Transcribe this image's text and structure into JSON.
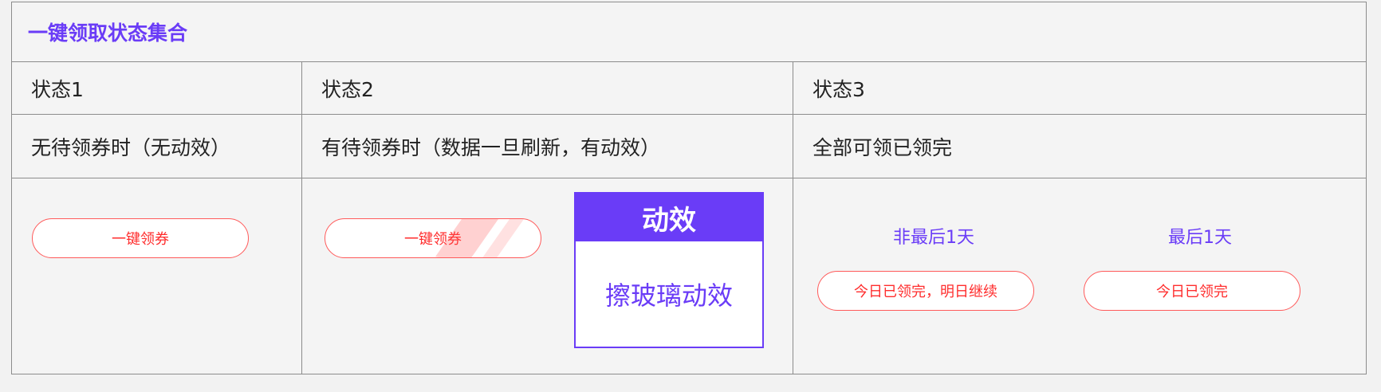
{
  "title": "一键领取状态集合",
  "columns": [
    {
      "header": "状态1",
      "desc": "无待领券时（无动效）"
    },
    {
      "header": "状态2",
      "desc": "有待领券时（数据一旦刷新，有动效）"
    },
    {
      "header": "状态3",
      "desc": "全部可领已领完"
    }
  ],
  "state1": {
    "button_label": "一键领券"
  },
  "state2": {
    "button_label": "一键领券",
    "anim_title": "动效",
    "anim_desc": "擦玻璃动效"
  },
  "state3": {
    "left_label": "非最后1天",
    "left_button": "今日已领完，明日继续",
    "right_label": "最后1天",
    "right_button": "今日已领完"
  },
  "colors": {
    "accent": "#6a3cf7",
    "button_red": "#ff2d2d",
    "border": "#8c8c8c"
  }
}
